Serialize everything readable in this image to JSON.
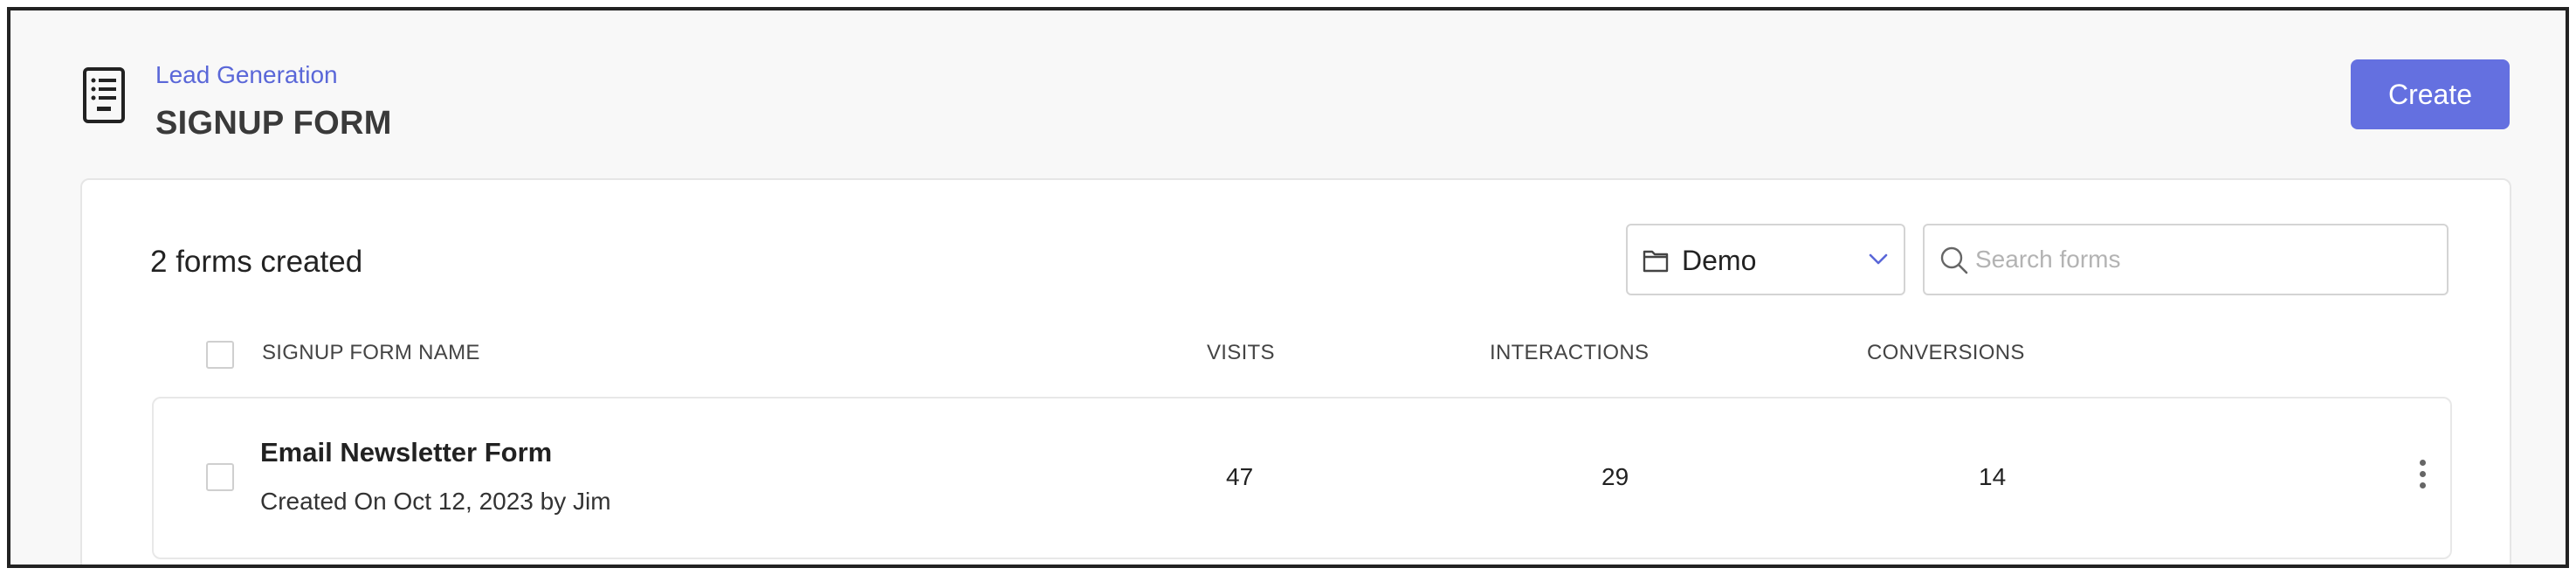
{
  "header": {
    "breadcrumb": "Lead Generation",
    "title": "SIGNUP FORM",
    "create_label": "Create",
    "icon": "list-document-icon"
  },
  "toolbar": {
    "forms_count": "2 forms created",
    "folder": {
      "selected": "Demo",
      "icon": "folder-icon"
    },
    "search": {
      "placeholder": "Search forms",
      "value": ""
    }
  },
  "table": {
    "columns": [
      "SIGNUP FORM NAME",
      "VISITS",
      "INTERACTIONS",
      "CONVERSIONS"
    ],
    "rows": [
      {
        "name": "Email Newsletter Form",
        "meta": "Created On Oct 12, 2023 by Jim",
        "visits": "47",
        "interactions": "29",
        "conversions": "14"
      }
    ]
  },
  "colors": {
    "accent": "#6470e0",
    "link": "#5a67d8",
    "background": "#f8f8f8"
  }
}
